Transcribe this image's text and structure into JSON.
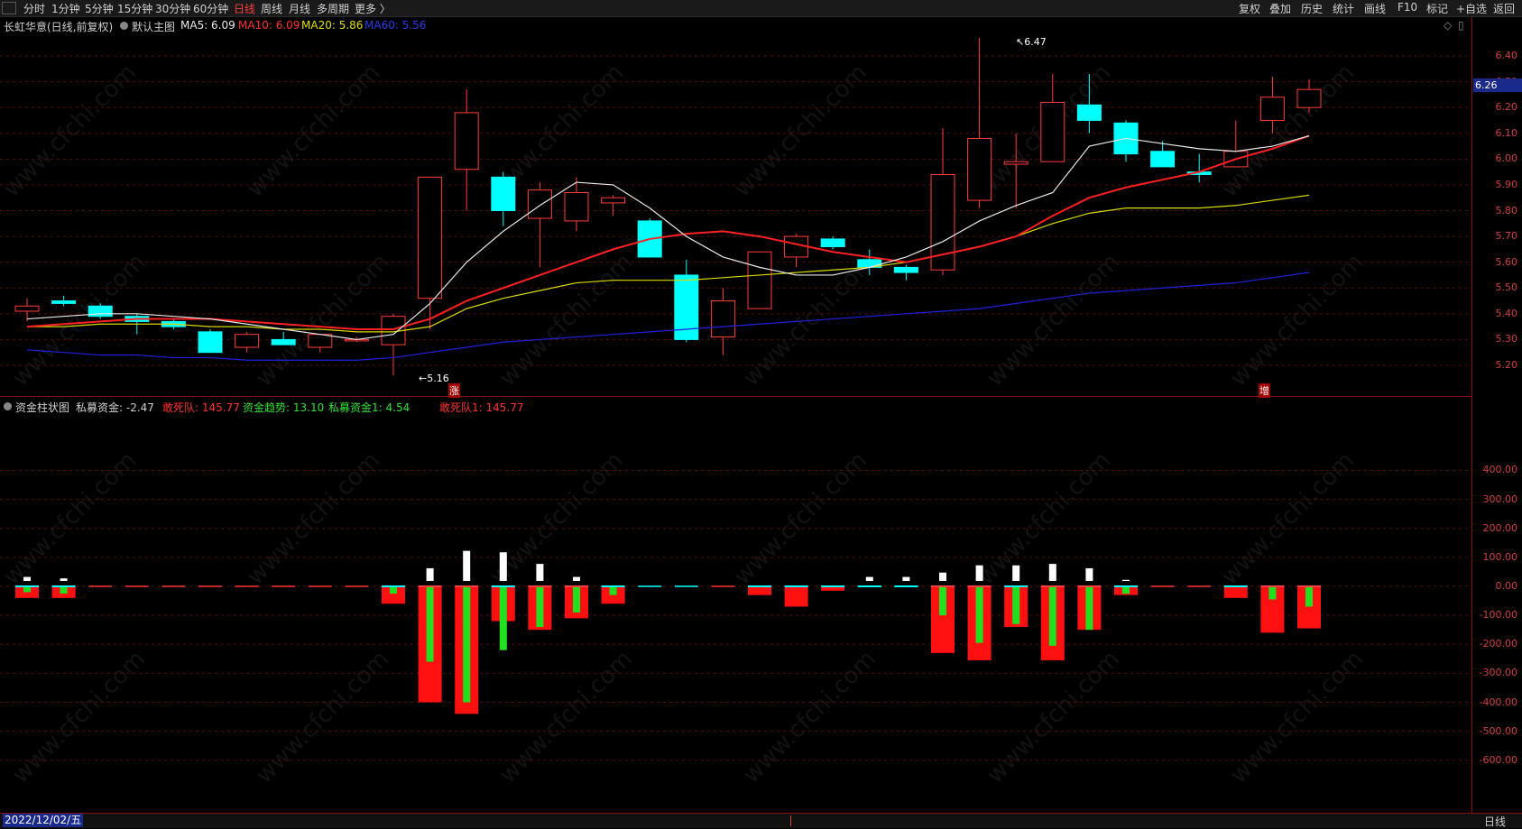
{
  "toolbar": {
    "periods": [
      "分时",
      "1分钟",
      "5分钟",
      "15分钟",
      "30分钟",
      "60分钟",
      "日线",
      "周线",
      "月线",
      "多周期",
      "更多 〉"
    ],
    "active_period": "日线",
    "right_buttons": [
      "复权",
      "叠加",
      "历史",
      "统计",
      "画线",
      "F10",
      "标记",
      "+自选",
      "返回"
    ]
  },
  "main_info": {
    "stock": "长虹华意(日线,前复权)",
    "chart_name": "默认主图",
    "ma5": "MA5: 6.09",
    "ma10": "MA10: 6.09",
    "ma20": "MA20: 5.86",
    "ma60": "MA60: 5.56"
  },
  "sub_info": {
    "title": "资金柱状图",
    "pf": "私募资金: -2.47",
    "dsd": "敢死队: 145.77",
    "trend": "资金趋势: 13.10",
    "pf1": "私募资金1: 4.54",
    "dsd1": "敢死队1: 145.77"
  },
  "price_axis": [
    "6.40",
    "6.30",
    "6.20",
    "6.10",
    "6.00",
    "5.90",
    "5.80",
    "5.70",
    "5.60",
    "5.50",
    "5.40",
    "5.30",
    "5.20"
  ],
  "current_price": "6.26",
  "sub_axis": [
    "400.00",
    "300.00",
    "200.00",
    "100.00",
    "0.00",
    "-100.00",
    "-200.00",
    "-300.00",
    "-400.00",
    "-500.00",
    "-600.00"
  ],
  "annotations": {
    "high": "6.47",
    "low": "5.16",
    "mark1": "涨",
    "mark2": "增"
  },
  "status": {
    "date": "2022/12/02/五",
    "period": "日线"
  },
  "watermark": "www.cfchi.com",
  "colors": {
    "up": "#ff3b3b",
    "down": "#00ffff",
    "ma5": "#e8e8e8",
    "ma10": "#ff2020",
    "ma20": "#d8d800",
    "ma60": "#2020e0"
  },
  "chart_data": {
    "type": "candlestick",
    "candles": [
      {
        "o": 5.41,
        "h": 5.46,
        "l": 5.37,
        "c": 5.43
      },
      {
        "o": 5.45,
        "h": 5.47,
        "l": 5.43,
        "c": 5.44
      },
      {
        "o": 5.43,
        "h": 5.44,
        "l": 5.38,
        "c": 5.39
      },
      {
        "o": 5.39,
        "h": 5.4,
        "l": 5.32,
        "c": 5.37
      },
      {
        "o": 5.37,
        "h": 5.38,
        "l": 5.34,
        "c": 5.35
      },
      {
        "o": 5.33,
        "h": 5.34,
        "l": 5.25,
        "c": 5.25
      },
      {
        "o": 5.27,
        "h": 5.33,
        "l": 5.25,
        "c": 5.32
      },
      {
        "o": 5.3,
        "h": 5.33,
        "l": 5.28,
        "c": 5.28
      },
      {
        "o": 5.27,
        "h": 5.32,
        "l": 5.25,
        "c": 5.32
      },
      {
        "o": 5.3,
        "h": 5.31,
        "l": 5.29,
        "c": 5.3
      },
      {
        "o": 5.28,
        "h": 5.4,
        "l": 5.16,
        "c": 5.39
      },
      {
        "o": 5.46,
        "h": 5.93,
        "l": 5.34,
        "c": 5.93
      },
      {
        "o": 5.96,
        "h": 6.27,
        "l": 5.8,
        "c": 6.18
      },
      {
        "o": 5.93,
        "h": 5.95,
        "l": 5.74,
        "c": 5.8
      },
      {
        "o": 5.77,
        "h": 5.91,
        "l": 5.58,
        "c": 5.88
      },
      {
        "o": 5.76,
        "h": 5.93,
        "l": 5.72,
        "c": 5.87
      },
      {
        "o": 5.83,
        "h": 5.86,
        "l": 5.78,
        "c": 5.85
      },
      {
        "o": 5.76,
        "h": 5.77,
        "l": 5.62,
        "c": 5.62
      },
      {
        "o": 5.55,
        "h": 5.61,
        "l": 5.29,
        "c": 5.3
      },
      {
        "o": 5.31,
        "h": 5.5,
        "l": 5.24,
        "c": 5.45
      },
      {
        "o": 5.42,
        "h": 5.64,
        "l": 5.42,
        "c": 5.64
      },
      {
        "o": 5.62,
        "h": 5.71,
        "l": 5.58,
        "c": 5.7
      },
      {
        "o": 5.69,
        "h": 5.7,
        "l": 5.65,
        "c": 5.66
      },
      {
        "o": 5.61,
        "h": 5.65,
        "l": 5.55,
        "c": 5.58
      },
      {
        "o": 5.58,
        "h": 5.59,
        "l": 5.53,
        "c": 5.56
      },
      {
        "o": 5.57,
        "h": 6.12,
        "l": 5.55,
        "c": 5.94
      },
      {
        "o": 5.84,
        "h": 6.47,
        "l": 5.81,
        "c": 6.08
      },
      {
        "o": 5.98,
        "h": 6.1,
        "l": 5.81,
        "c": 5.99
      },
      {
        "o": 5.99,
        "h": 6.33,
        "l": 5.99,
        "c": 6.22
      },
      {
        "o": 6.21,
        "h": 6.33,
        "l": 6.1,
        "c": 6.15
      },
      {
        "o": 6.14,
        "h": 6.15,
        "l": 5.99,
        "c": 6.02
      },
      {
        "o": 6.03,
        "h": 6.07,
        "l": 5.97,
        "c": 5.97
      },
      {
        "o": 5.95,
        "h": 6.02,
        "l": 5.91,
        "c": 5.94
      },
      {
        "o": 5.97,
        "h": 6.15,
        "l": 5.97,
        "c": 6.03
      },
      {
        "o": 6.15,
        "h": 6.32,
        "l": 6.1,
        "c": 6.24
      },
      {
        "o": 6.2,
        "h": 6.31,
        "l": 6.18,
        "c": 6.27
      }
    ],
    "ma5": [
      5.38,
      5.39,
      5.4,
      5.4,
      5.39,
      5.38,
      5.36,
      5.34,
      5.32,
      5.3,
      5.32,
      5.44,
      5.6,
      5.72,
      5.82,
      5.91,
      5.9,
      5.81,
      5.7,
      5.62,
      5.58,
      5.55,
      5.55,
      5.58,
      5.62,
      5.68,
      5.76,
      5.82,
      5.87,
      6.05,
      6.08,
      6.06,
      6.04,
      6.03,
      6.05,
      6.09
    ],
    "ma10": [
      5.35,
      5.36,
      5.37,
      5.38,
      5.38,
      5.38,
      5.37,
      5.36,
      5.35,
      5.34,
      5.34,
      5.38,
      5.45,
      5.5,
      5.55,
      5.6,
      5.65,
      5.69,
      5.71,
      5.72,
      5.7,
      5.67,
      5.64,
      5.62,
      5.6,
      5.63,
      5.66,
      5.7,
      5.78,
      5.85,
      5.89,
      5.92,
      5.95,
      6.0,
      6.04,
      6.09
    ],
    "ma20": [
      5.35,
      5.35,
      5.36,
      5.36,
      5.36,
      5.35,
      5.35,
      5.34,
      5.34,
      5.33,
      5.33,
      5.35,
      5.42,
      5.46,
      5.49,
      5.52,
      5.53,
      5.53,
      5.53,
      5.54,
      5.55,
      5.56,
      5.57,
      5.58,
      5.6,
      5.63,
      5.66,
      5.7,
      5.75,
      5.79,
      5.81,
      5.81,
      5.81,
      5.82,
      5.84,
      5.86
    ],
    "ma60": [
      5.26,
      5.25,
      5.24,
      5.24,
      5.23,
      5.23,
      5.22,
      5.22,
      5.22,
      5.22,
      5.23,
      5.25,
      5.27,
      5.29,
      5.3,
      5.31,
      5.32,
      5.33,
      5.34,
      5.35,
      5.36,
      5.37,
      5.38,
      5.39,
      5.4,
      5.41,
      5.42,
      5.44,
      5.46,
      5.48,
      5.49,
      5.5,
      5.51,
      5.52,
      5.54,
      5.56
    ],
    "dsd": [
      -40,
      -40,
      -2,
      -2,
      -2,
      -2,
      -2,
      -2,
      -2,
      -2,
      -60,
      -400,
      -440,
      -120,
      -150,
      -110,
      -60,
      -2,
      -2,
      2,
      -30,
      -70,
      -15,
      2,
      2,
      -230,
      -255,
      -140,
      -255,
      -150,
      -30,
      -2,
      -2,
      -40,
      -160,
      -145
    ],
    "trend": [
      -20,
      -25,
      0,
      0,
      0,
      0,
      0,
      0,
      0,
      0,
      -25,
      -260,
      -400,
      -220,
      -140,
      -90,
      -30,
      0,
      0,
      0,
      0,
      0,
      0,
      0,
      0,
      -100,
      -195,
      -130,
      -205,
      -150,
      -25,
      0,
      0,
      0,
      -45,
      -70
    ],
    "pf": [
      20,
      15,
      0,
      0,
      0,
      0,
      0,
      0,
      0,
      0,
      0,
      50,
      110,
      105,
      65,
      20,
      0,
      0,
      0,
      0,
      0,
      0,
      0,
      20,
      20,
      35,
      60,
      60,
      65,
      50,
      10,
      0,
      0,
      0,
      0,
      0
    ],
    "ylim": [
      5.16,
      6.47
    ],
    "sub_ylim": [
      -650,
      450
    ]
  }
}
